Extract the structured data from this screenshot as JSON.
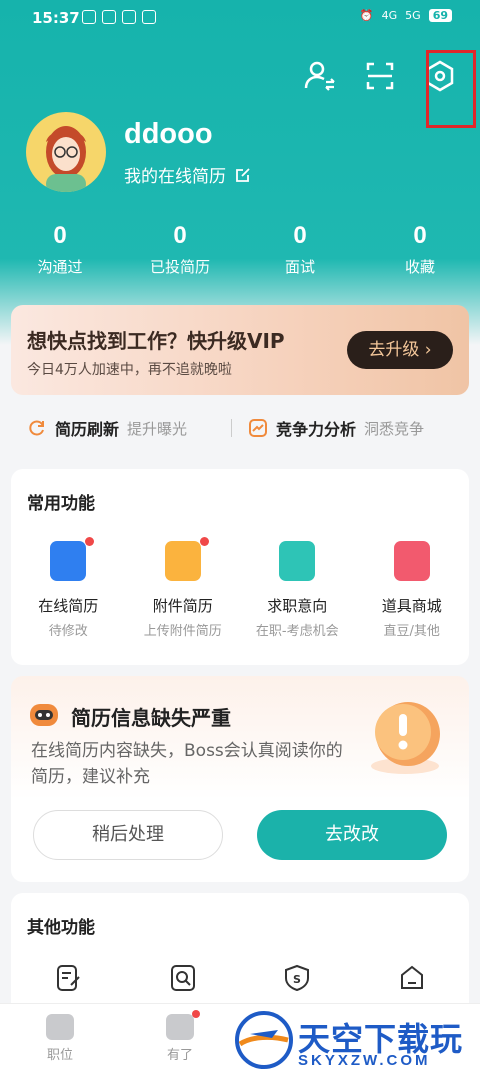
{
  "status_bar": {
    "time": "15:37",
    "network": "4G",
    "network2": "5G",
    "battery": "69"
  },
  "profile": {
    "username": "ddooo",
    "resume_link": "我的在线简历"
  },
  "stats": [
    {
      "value": "0",
      "label": "沟通过"
    },
    {
      "value": "0",
      "label": "已投简历"
    },
    {
      "value": "0",
      "label": "面试"
    },
    {
      "value": "0",
      "label": "收藏"
    }
  ],
  "vip_banner": {
    "title": "想快点找到工作？快升级VIP",
    "subtitle": "今日4万人加速中，再不追就晚啦",
    "button": "去升级 ›"
  },
  "quick": {
    "refresh": {
      "label": "简历刷新",
      "sub": "提升曝光"
    },
    "analysis": {
      "label": "竞争力分析",
      "sub": "洞悉竞争"
    }
  },
  "common": {
    "title": "常用功能",
    "items": [
      {
        "name": "在线简历",
        "sub": "待修改",
        "color": "#2f7ff0"
      },
      {
        "name": "附件简历",
        "sub": "上传附件简历",
        "color": "#fbb33e"
      },
      {
        "name": "求职意向",
        "sub": "在职-考虑机会",
        "color": "#2ec4b6"
      },
      {
        "name": "道具商城",
        "sub": "直豆/其他",
        "color": "#f25a6e"
      }
    ]
  },
  "warning": {
    "title": "简历信息缺失严重",
    "desc": "在线简历内容缺失，Boss会认真阅读你的简历，建议补充",
    "later": "稍后处理",
    "go": "去改改"
  },
  "other": {
    "title": "其他功能"
  },
  "tabbar": {
    "jobs": "职位",
    "community": "有了"
  },
  "watermark": {
    "top": "天空下载玩",
    "bottom": "SKYXZW.COM"
  },
  "colors": {
    "primary": "#1bb2aa",
    "dot": "#f04848"
  }
}
